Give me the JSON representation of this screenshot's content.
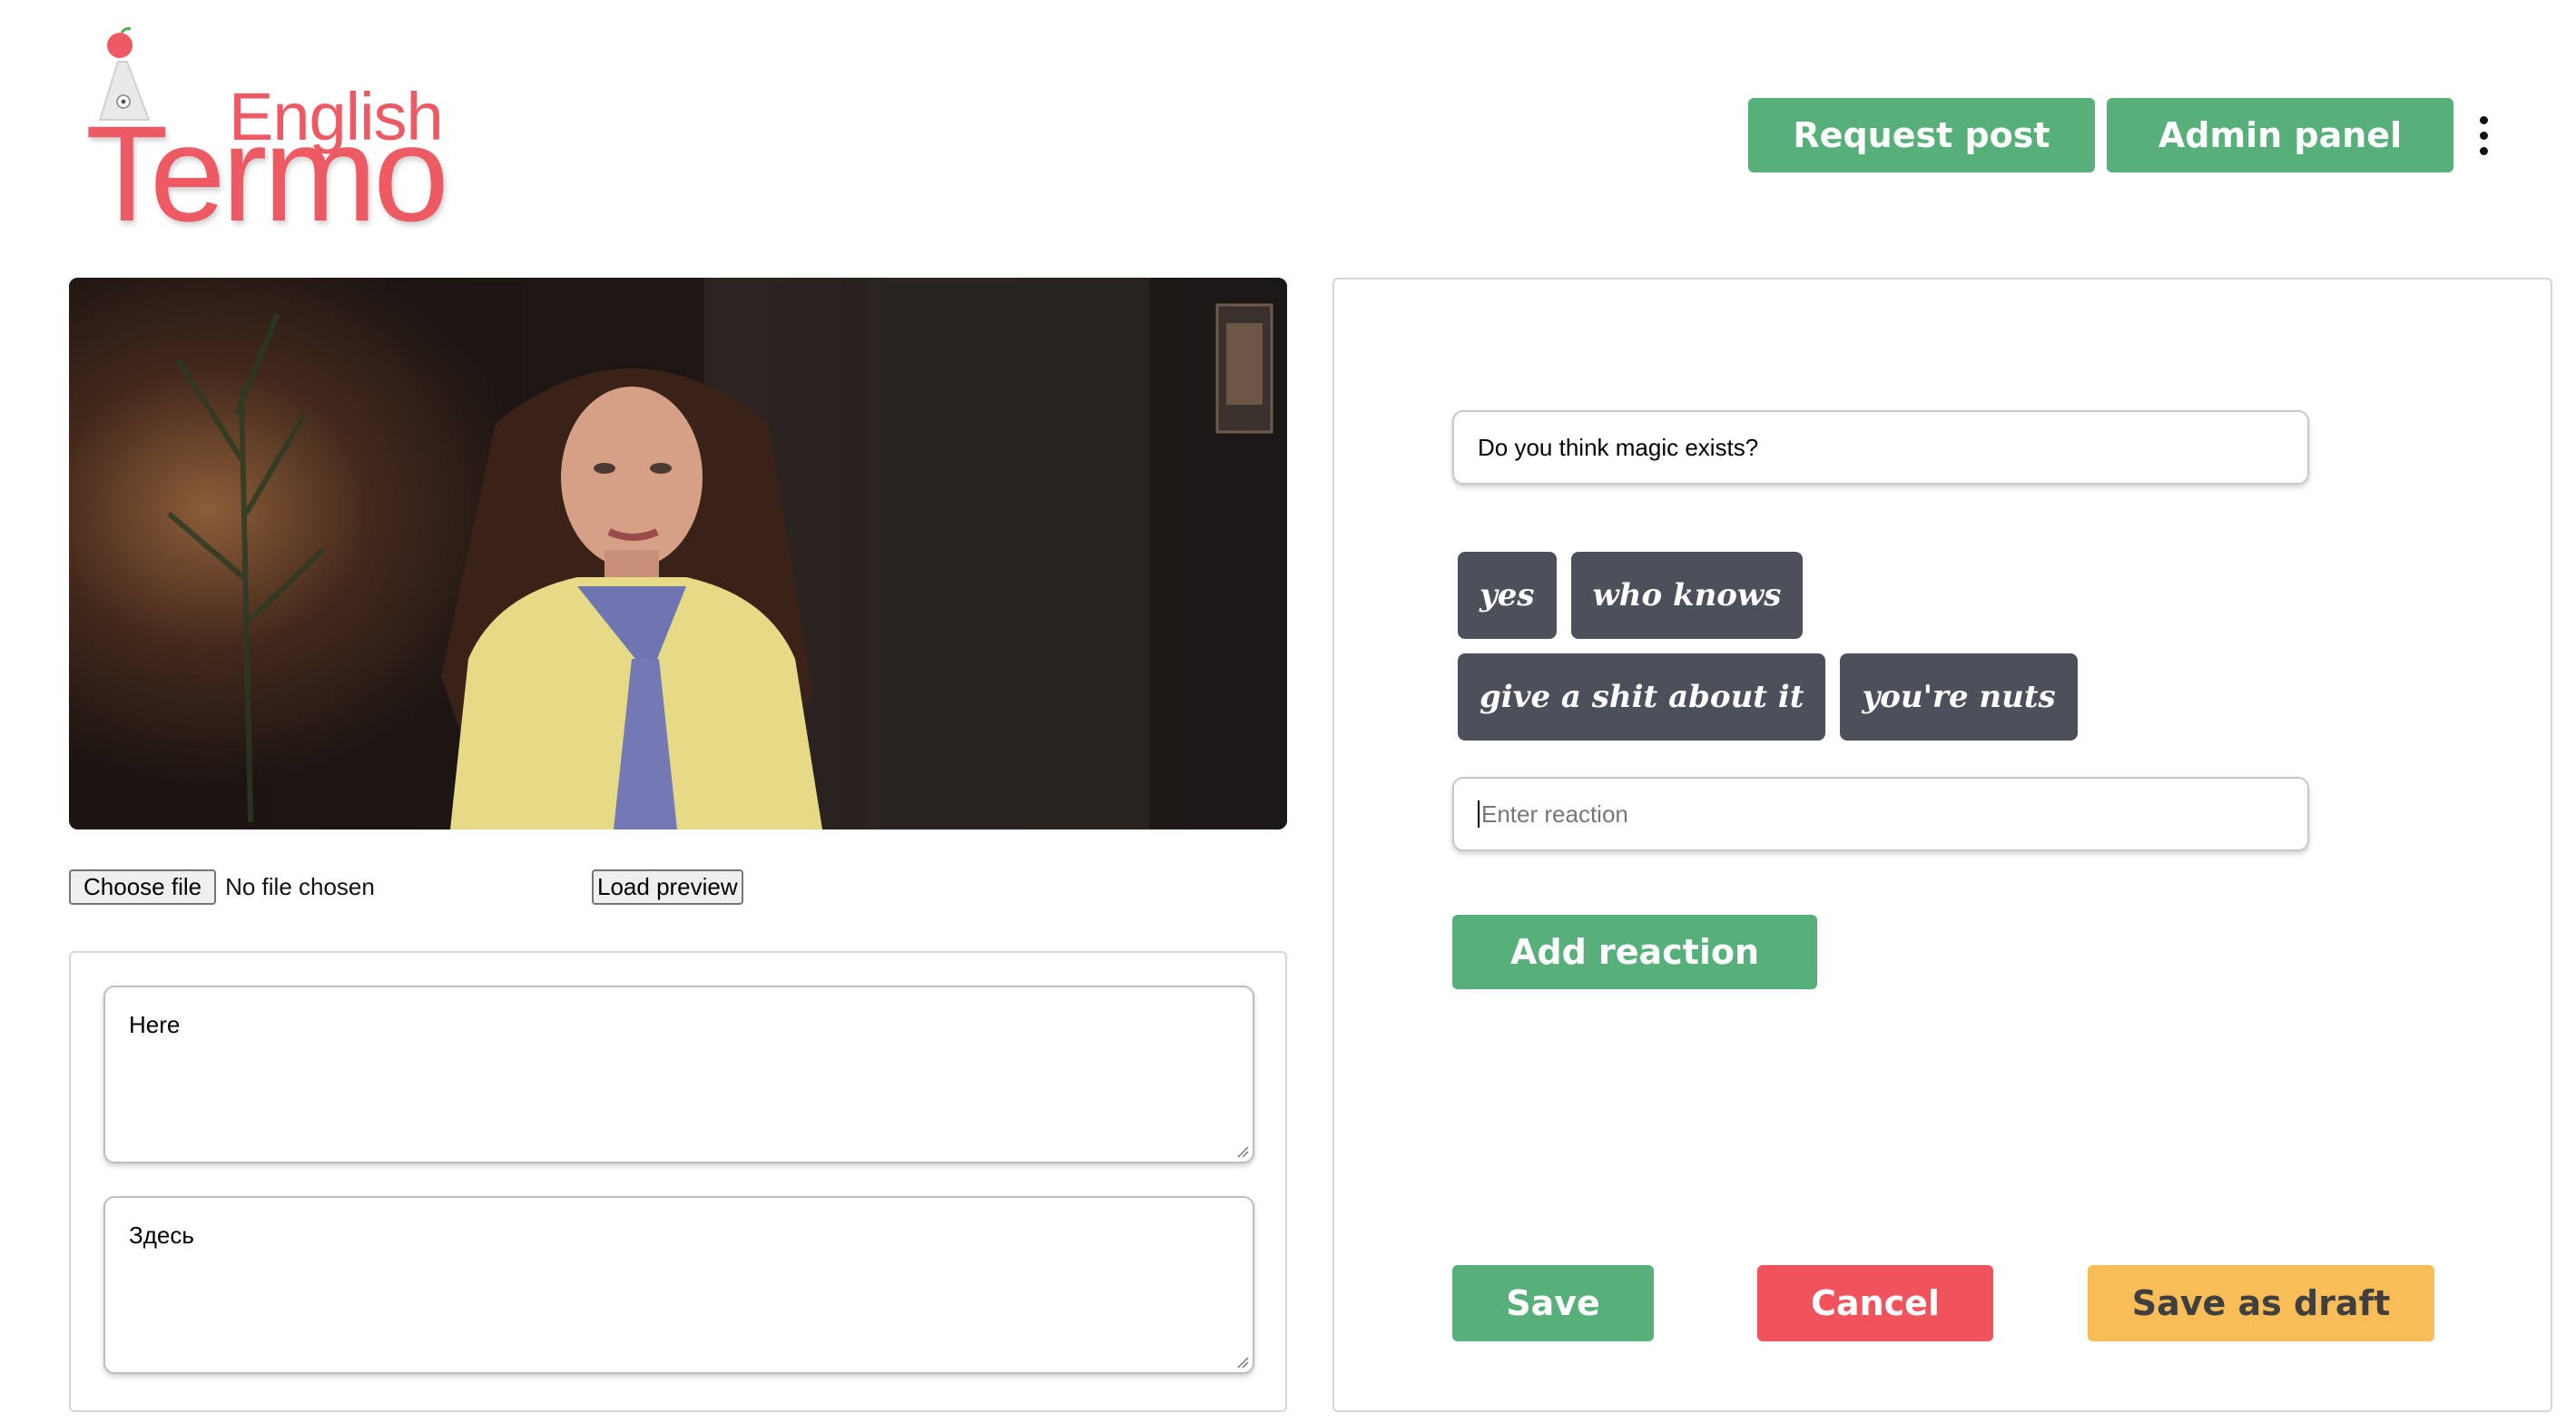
{
  "brand": {
    "small": "English",
    "large": "Termo"
  },
  "header": {
    "request_post_label": "Request post",
    "admin_panel_label": "Admin panel",
    "more_icon": "kebab-menu-icon"
  },
  "upload": {
    "choose_file_label": "Choose file",
    "file_status": "No file chosen",
    "load_preview_label": "Load preview"
  },
  "translations": {
    "english": "Here",
    "russian": "Здесь"
  },
  "question": {
    "value": "Do you think magic exists?"
  },
  "reactions": [
    {
      "label": "yes"
    },
    {
      "label": "who knows"
    },
    {
      "label": "give a shit about it"
    },
    {
      "label": "you're nuts"
    }
  ],
  "reaction_input": {
    "placeholder": "Enter reaction",
    "value": ""
  },
  "add_reaction_label": "Add reaction",
  "actions": {
    "save_label": "Save",
    "cancel_label": "Cancel",
    "draft_label": "Save as draft"
  },
  "colors": {
    "brand": "#ee5a63",
    "primary": "#57b07a",
    "danger": "#f0535c",
    "warning": "#f8bd57",
    "chip": "#4b505b"
  }
}
